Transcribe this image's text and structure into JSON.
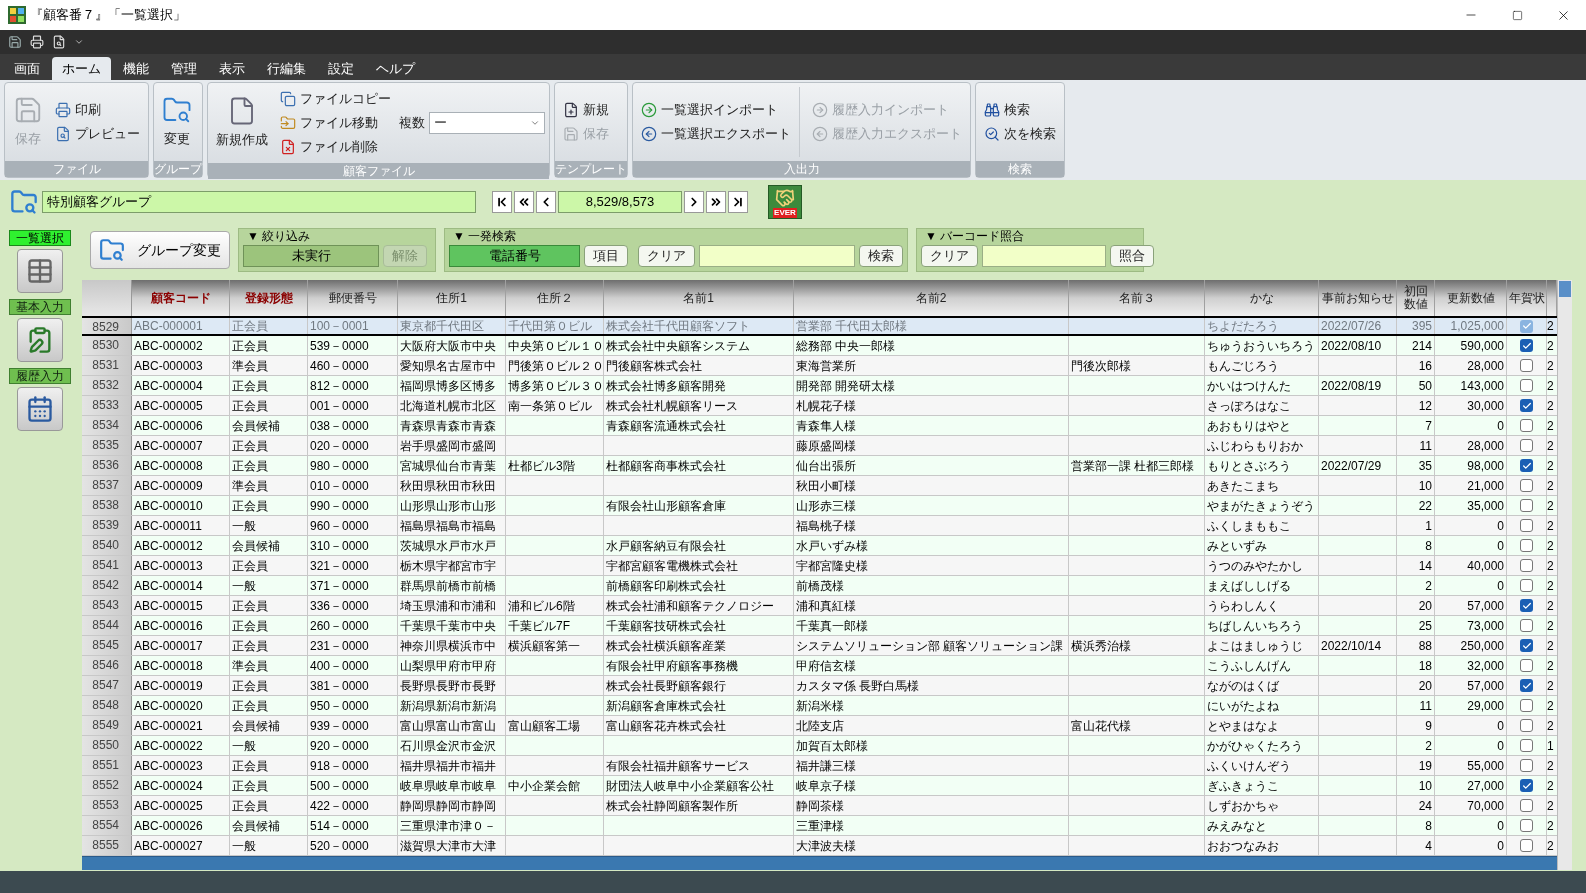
{
  "window": {
    "title": "『顧客番７』「一覧選択」"
  },
  "ribbon": {
    "tabs": [
      {
        "label": "画面",
        "selected": false
      },
      {
        "label": "ホーム",
        "selected": true
      },
      {
        "label": "機能",
        "selected": false
      },
      {
        "label": "管理",
        "selected": false
      },
      {
        "label": "表示",
        "selected": false
      },
      {
        "label": "行編集",
        "selected": false
      },
      {
        "label": "設定",
        "selected": false
      },
      {
        "label": "ヘルプ",
        "selected": false
      }
    ],
    "groups": [
      {
        "label": "ファイル",
        "columns": [
          [
            {
              "kind": "large",
              "label": "保存",
              "disabled": true
            }
          ],
          [
            {
              "kind": "small",
              "label": "印刷",
              "disabled": false
            },
            {
              "kind": "small",
              "label": "プレビュー",
              "disabled": false
            }
          ]
        ]
      },
      {
        "label": "グループ",
        "columns": [
          [
            {
              "kind": "large",
              "label": "変更",
              "disabled": false
            }
          ]
        ]
      },
      {
        "label": "顧客ファイル",
        "columns": [
          [
            {
              "kind": "large",
              "label": "新規作成",
              "disabled": false
            }
          ],
          [
            {
              "kind": "small",
              "label": "ファイルコピー",
              "disabled": false
            },
            {
              "kind": "small",
              "label": "ファイル移動",
              "disabled": false
            },
            {
              "kind": "small",
              "label": "ファイル削除",
              "disabled": false
            }
          ],
          [
            {
              "kind": "dropdown",
              "label": "複数",
              "value": "ー",
              "disabled": false
            }
          ]
        ]
      },
      {
        "label": "テンプレート",
        "columns": [
          [
            {
              "kind": "small",
              "label": "新規",
              "disabled": false
            },
            {
              "kind": "small",
              "label": "保存",
              "disabled": true
            }
          ]
        ]
      },
      {
        "label": "入出力",
        "columns": [
          [
            {
              "kind": "small",
              "label": "一覧選択インポート",
              "disabled": false
            },
            {
              "kind": "small",
              "label": "一覧選択エクスポート",
              "disabled": false
            }
          ],
          [
            {
              "kind": "small",
              "label": "履歴入力インポート",
              "disabled": true
            },
            {
              "kind": "small",
              "label": "履歴入力エクスポート",
              "disabled": true
            }
          ]
        ]
      },
      {
        "label": "検索",
        "columns": [
          [
            {
              "kind": "small",
              "label": "検索",
              "disabled": false
            },
            {
              "kind": "small",
              "label": "次を検索",
              "disabled": false
            }
          ]
        ]
      }
    ]
  },
  "navigator": {
    "group": "特別顧客グループ",
    "record": "8,529/8,573",
    "badge": "EVER"
  },
  "side_menu": [
    {
      "label": "一覧選択",
      "selected": true
    },
    {
      "label": "基本入力",
      "selected": false
    },
    {
      "label": "履歴入力",
      "selected": false
    }
  ],
  "group_change": "グループ変更",
  "filter": {
    "title": "▼ 絞り込み",
    "status": "未実行",
    "clear": "解除"
  },
  "quick_search": {
    "title": "▼ 一発検索",
    "field": "電話番号",
    "item": "項目",
    "clear": "クリア",
    "search": "検索"
  },
  "barcode": {
    "title": "▼ バーコード照合",
    "clear": "クリア",
    "match": "照合"
  },
  "table": {
    "columns": [
      {
        "label": "顧客コード",
        "emphasized": true
      },
      {
        "label": "登録形態",
        "emphasized": true
      },
      {
        "label": "郵便番号",
        "emphasized": false
      },
      {
        "label": "住所1",
        "emphasized": false
      },
      {
        "label": "住所２",
        "emphasized": false
      },
      {
        "label": "名前1",
        "emphasized": false
      },
      {
        "label": "名前2",
        "emphasized": false
      },
      {
        "label": "名前３",
        "emphasized": false
      },
      {
        "label": "かな",
        "emphasized": false
      },
      {
        "label": "事前お知らせ",
        "emphasized": false
      },
      {
        "label": "初回数値",
        "emphasized": false
      },
      {
        "label": "更新数値",
        "emphasized": false
      },
      {
        "label": "年賀状",
        "emphasized": false
      }
    ],
    "rows": [
      {
        "number": "8529",
        "selected": true,
        "cells": [
          "ABC-000001",
          "正会員",
          "100－0001",
          "東京都千代田区",
          "千代田第０ビル",
          "株式会社千代田顧客ソフト",
          "営業部 千代田太郎様",
          "",
          "ちよだたろう",
          "2022/07/26",
          "395",
          "1,025,000"
        ],
        "checked": true,
        "column_14": "2"
      },
      {
        "number": "8530",
        "selected": false,
        "cells": [
          "ABC-000002",
          "正会員",
          "539－0000",
          "大阪府大阪市中央",
          "中央第０ビル１０",
          "株式会社中央顧客システム",
          "総務部 中央一郎様",
          "",
          "ちゅうおういちろう",
          "2022/08/10",
          "214",
          "590,000"
        ],
        "checked": true,
        "column_14": "2"
      },
      {
        "number": "8531",
        "selected": false,
        "cells": [
          "ABC-000003",
          "準会員",
          "460－0000",
          "愛知県名古屋市中",
          "門後第０ビル２０",
          "門後顧客株式会社",
          "東海営業所",
          "門後次郎様",
          "もんごじろう",
          "",
          "16",
          "28,000"
        ],
        "checked": false,
        "column_14": "2"
      },
      {
        "number": "8532",
        "selected": false,
        "cells": [
          "ABC-000004",
          "正会員",
          "812－0000",
          "福岡県博多区博多",
          "博多第０ビル３０",
          "株式会社博多顧客開発",
          "開発部 開発研太様",
          "",
          "かいはつけんた",
          "2022/08/19",
          "50",
          "143,000"
        ],
        "checked": false,
        "column_14": "2"
      },
      {
        "number": "8533",
        "selected": false,
        "cells": [
          "ABC-000005",
          "正会員",
          "001－0000",
          "北海道札幌市北区",
          "南一条第０ビル",
          "株式会社札幌顧客リース",
          "札幌花子様",
          "",
          "さっぽろはなこ",
          "",
          "12",
          "30,000"
        ],
        "checked": true,
        "column_14": "2"
      },
      {
        "number": "8534",
        "selected": false,
        "cells": [
          "ABC-000006",
          "会員候補",
          "038－0000",
          "青森県青森市青森",
          "",
          "青森顧客流通株式会社",
          "青森隼人様",
          "",
          "あおもりはやと",
          "",
          "7",
          "0"
        ],
        "checked": false,
        "column_14": "2"
      },
      {
        "number": "8535",
        "selected": false,
        "cells": [
          "ABC-000007",
          "正会員",
          "020－0000",
          "岩手県盛岡市盛岡",
          "",
          "",
          "藤原盛岡様",
          "",
          "ふじわらもりおか",
          "",
          "11",
          "28,000"
        ],
        "checked": false,
        "column_14": "2"
      },
      {
        "number": "8536",
        "selected": false,
        "cells": [
          "ABC-000008",
          "正会員",
          "980－0000",
          "宮城県仙台市青葉",
          "杜都ビル3階",
          "杜都顧客商事株式会社",
          "仙台出張所",
          "営業部一課 杜都三郎様",
          "もりとさぶろう",
          "2022/07/29",
          "35",
          "98,000"
        ],
        "checked": true,
        "column_14": "2"
      },
      {
        "number": "8537",
        "selected": false,
        "cells": [
          "ABC-000009",
          "準会員",
          "010－0000",
          "秋田県秋田市秋田",
          "",
          "",
          "秋田小町様",
          "",
          "あきたこまち",
          "",
          "10",
          "21,000"
        ],
        "checked": false,
        "column_14": "2"
      },
      {
        "number": "8538",
        "selected": false,
        "cells": [
          "ABC-000010",
          "正会員",
          "990－0000",
          "山形県山形市山形",
          "",
          "有限会社山形顧客倉庫",
          "山形赤三様",
          "",
          "やまがたきょうぞう",
          "",
          "22",
          "35,000"
        ],
        "checked": false,
        "column_14": "2"
      },
      {
        "number": "8539",
        "selected": false,
        "cells": [
          "ABC-000011",
          "一般",
          "960－0000",
          "福島県福島市福島",
          "",
          "",
          "福島桃子様",
          "",
          "ふくしまももこ",
          "",
          "1",
          "0"
        ],
        "checked": false,
        "column_14": "2"
      },
      {
        "number": "8540",
        "selected": false,
        "cells": [
          "ABC-000012",
          "会員候補",
          "310－0000",
          "茨城県水戸市水戸",
          "",
          "水戸顧客納豆有限会社",
          "水戸いずみ様",
          "",
          "みといずみ",
          "",
          "8",
          "0"
        ],
        "checked": false,
        "column_14": "2"
      },
      {
        "number": "8541",
        "selected": false,
        "cells": [
          "ABC-000013",
          "正会員",
          "321－0000",
          "栃木県宇都宮市宇",
          "",
          "宇都宮顧客電機株式会社",
          "宇都宮隆史様",
          "",
          "うつのみやたかし",
          "",
          "14",
          "40,000"
        ],
        "checked": false,
        "column_14": "2"
      },
      {
        "number": "8542",
        "selected": false,
        "cells": [
          "ABC-000014",
          "一般",
          "371－0000",
          "群馬県前橋市前橋",
          "",
          "前橋顧客印刷株式会社",
          "前橋茂様",
          "",
          "まえばししげる",
          "",
          "2",
          "0"
        ],
        "checked": false,
        "column_14": "2"
      },
      {
        "number": "8543",
        "selected": false,
        "cells": [
          "ABC-000015",
          "正会員",
          "336－0000",
          "埼玉県浦和市浦和",
          "浦和ビル6階",
          "株式会社浦和顧客テクノロジー",
          "浦和真紅様",
          "",
          "うらわしんく",
          "",
          "20",
          "57,000"
        ],
        "checked": true,
        "column_14": "2"
      },
      {
        "number": "8544",
        "selected": false,
        "cells": [
          "ABC-000016",
          "正会員",
          "260－0000",
          "千葉県千葉市中央",
          "千葉ビル7F",
          "千葉顧客技研株式会社",
          "千葉真一郎様",
          "",
          "ちばしんいちろう",
          "",
          "25",
          "73,000"
        ],
        "checked": false,
        "column_14": "2"
      },
      {
        "number": "8545",
        "selected": false,
        "cells": [
          "ABC-000017",
          "正会員",
          "231－0000",
          "神奈川県横浜市中",
          "横浜顧客第一",
          "株式会社横浜顧客産業",
          "システムソリューション部 顧客ソリューション課",
          "横浜秀治様",
          "よこはましゅうじ",
          "2022/10/14",
          "88",
          "250,000"
        ],
        "checked": true,
        "column_14": "2"
      },
      {
        "number": "8546",
        "selected": false,
        "cells": [
          "ABC-000018",
          "準会員",
          "400－0000",
          "山梨県甲府市甲府",
          "",
          "有限会社甲府顧客事務機",
          "甲府信玄様",
          "",
          "こうふしんげん",
          "",
          "18",
          "32,000"
        ],
        "checked": false,
        "column_14": "2"
      },
      {
        "number": "8547",
        "selected": false,
        "cells": [
          "ABC-000019",
          "正会員",
          "381－0000",
          "長野県長野市長野",
          "",
          "株式会社長野顧客銀行",
          "カスタマ係 長野白馬様",
          "",
          "ながのはくば",
          "",
          "20",
          "57,000"
        ],
        "checked": true,
        "column_14": "2"
      },
      {
        "number": "8548",
        "selected": false,
        "cells": [
          "ABC-000020",
          "正会員",
          "950－0000",
          "新潟県新潟市新潟",
          "",
          "新潟顧客倉庫株式会社",
          "新潟米様",
          "",
          "にいがたよね",
          "",
          "11",
          "29,000"
        ],
        "checked": false,
        "column_14": "2"
      },
      {
        "number": "8549",
        "selected": false,
        "cells": [
          "ABC-000021",
          "会員候補",
          "939－0000",
          "富山県富山市富山",
          "富山顧客工場",
          "富山顧客花卉株式会社",
          "北陸支店",
          "富山花代様",
          "とやまはなよ",
          "",
          "9",
          "0"
        ],
        "checked": false,
        "column_14": "2"
      },
      {
        "number": "8550",
        "selected": false,
        "cells": [
          "ABC-000022",
          "一般",
          "920－0000",
          "石川県金沢市金沢",
          "",
          "",
          "加賀百太郎様",
          "",
          "かがひゃくたろう",
          "",
          "2",
          "0"
        ],
        "checked": false,
        "column_14": "1"
      },
      {
        "number": "8551",
        "selected": false,
        "cells": [
          "ABC-000023",
          "正会員",
          "918－0000",
          "福井県福井市福井",
          "",
          "有限会社福井顧客サービス",
          "福井謙三様",
          "",
          "ふくいけんぞう",
          "",
          "19",
          "55,000"
        ],
        "checked": false,
        "column_14": "2"
      },
      {
        "number": "8552",
        "selected": false,
        "cells": [
          "ABC-000024",
          "正会員",
          "500－0000",
          "岐阜県岐阜市岐阜",
          "中小企業会館",
          "財団法人岐阜中小企業顧客公社",
          "岐阜京子様",
          "",
          "ぎふきょうこ",
          "",
          "10",
          "27,000"
        ],
        "checked": true,
        "column_14": "2"
      },
      {
        "number": "8553",
        "selected": false,
        "cells": [
          "ABC-000025",
          "正会員",
          "422－0000",
          "静岡県静岡市静岡",
          "",
          "株式会社静岡顧客製作所",
          "静岡茶様",
          "",
          "しずおかちゃ",
          "",
          "24",
          "70,000"
        ],
        "checked": false,
        "column_14": "2"
      },
      {
        "number": "8554",
        "selected": false,
        "cells": [
          "ABC-000026",
          "会員候補",
          "514－0000",
          "三重県津市津０－",
          "",
          "",
          "三重津様",
          "",
          "みえみなと",
          "",
          "8",
          "0"
        ],
        "checked": false,
        "column_14": "2"
      },
      {
        "number": "8555",
        "selected": false,
        "cells": [
          "ABC-000027",
          "一般",
          "520－0000",
          "滋賀県大津市大津",
          "",
          "",
          "大津波夫様",
          "",
          "おおつなみお",
          "",
          "4",
          "0"
        ],
        "checked": false,
        "column_14": "2"
      }
    ]
  }
}
